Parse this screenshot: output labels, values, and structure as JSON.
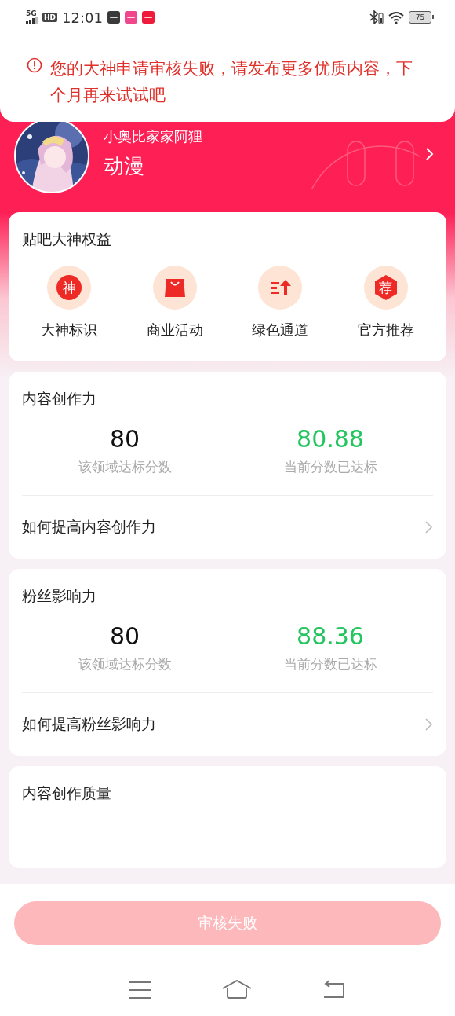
{
  "status_bar": {
    "network": "5G",
    "hd": "HD",
    "time": "12:01",
    "battery": "75"
  },
  "alert": {
    "message": "您的大神申请审核失败，请发布更多优质内容，下个月再来试试吧"
  },
  "profile": {
    "name": "小奥比家家阿狸",
    "category": "动漫"
  },
  "benefits": {
    "title": "贴吧大神权益",
    "items": [
      {
        "label": "大神标识",
        "kind": "seal",
        "glyph": "神"
      },
      {
        "label": "商业活动",
        "kind": "bag"
      },
      {
        "label": "绿色通道",
        "kind": "fast"
      },
      {
        "label": "官方推荐",
        "kind": "hexagon",
        "glyph": "荐"
      }
    ]
  },
  "metrics": [
    {
      "title": "内容创作力",
      "target_value": "80",
      "target_label": "该领域达标分数",
      "current_value": "80.88",
      "current_label": "当前分数已达标",
      "passed": true,
      "link": "如何提高内容创作力"
    },
    {
      "title": "粉丝影响力",
      "target_value": "80",
      "target_label": "该领域达标分数",
      "current_value": "88.36",
      "current_label": "当前分数已达标",
      "passed": true,
      "link": "如何提高粉丝影响力"
    },
    {
      "title": "内容创作质量"
    }
  ],
  "action_button": {
    "label": "审核失败",
    "disabled": true
  }
}
